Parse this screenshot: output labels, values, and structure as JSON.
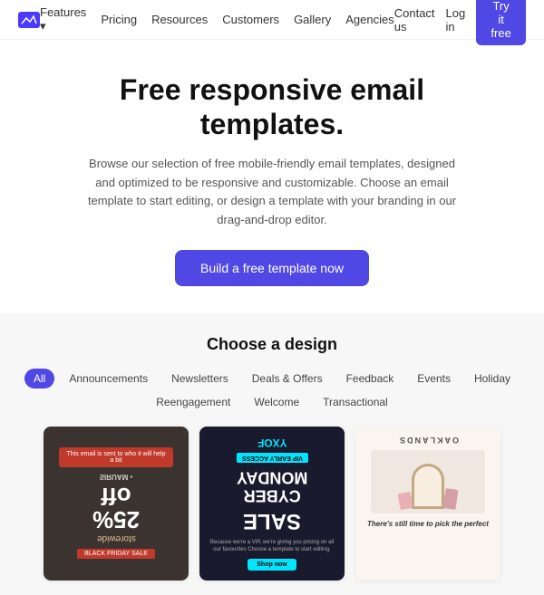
{
  "nav": {
    "logo_alt": "Mailjet logo",
    "links": [
      {
        "label": "Features",
        "has_dropdown": true
      },
      {
        "label": "Pricing"
      },
      {
        "label": "Resources"
      },
      {
        "label": "Customers"
      },
      {
        "label": "Gallery"
      },
      {
        "label": "Agencies"
      }
    ],
    "right_links": [
      "Contact us",
      "Log in"
    ],
    "cta": "Try it free"
  },
  "hero": {
    "title": "Free responsive email templates.",
    "description": "Browse our selection of free mobile-friendly email templates, designed and optimized to be responsive and customizable. Choose an email template to start editing, or design a template with your branding in our drag-and-drop editor.",
    "cta": "Build a free template now"
  },
  "design": {
    "heading": "Choose a design",
    "filters": [
      {
        "label": "All",
        "active": true
      },
      {
        "label": "Announcements"
      },
      {
        "label": "Newsletters"
      },
      {
        "label": "Deals & Offers"
      },
      {
        "label": "Feedback"
      },
      {
        "label": "Events"
      },
      {
        "label": "Holiday"
      },
      {
        "label": "Reengagement"
      },
      {
        "label": "Welcome"
      },
      {
        "label": "Transactional"
      }
    ]
  },
  "cards": [
    {
      "type": "sale",
      "logo": "SIRUAM",
      "top_text": "This email is sent to who it will help a bit",
      "main_text": "25% off",
      "sub_text": "storewide",
      "label": "BLACK FRIDAY SALE"
    },
    {
      "type": "cyber",
      "logo": "YXOF",
      "tag": "VIP EARLY ACCESS",
      "main_text": "CYBER MONDAY",
      "sale": "SALE",
      "body_text": "Because we're a VIP, we're giving you pricing on all our favourites Choose a template to start editing.",
      "cta": "Shop now"
    },
    {
      "type": "oaklands",
      "brand": "OAKLANDS",
      "body_text": "There's still time to pick the perfect"
    }
  ]
}
